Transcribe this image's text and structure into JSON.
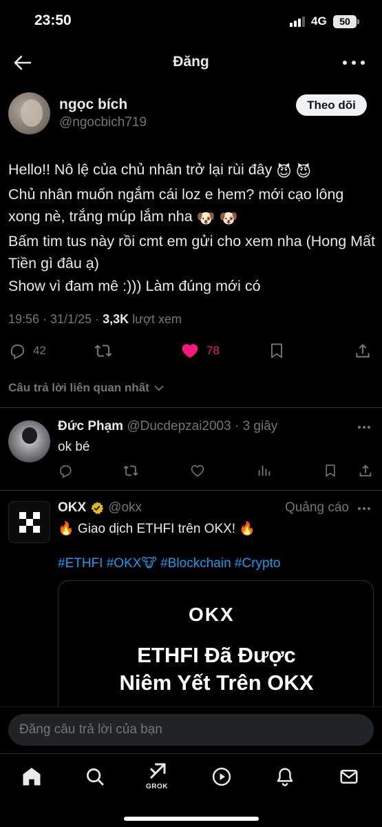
{
  "status_bar": {
    "time": "23:50",
    "network": "4G",
    "battery": "50"
  },
  "header": {
    "title": "Đăng"
  },
  "tweet": {
    "author_name": "ngọc bích",
    "author_handle": "@ngocbich719",
    "follow_label": "Theo dõi",
    "lines": [
      "Hello!! Nô lệ của chủ nhân trở lại rùi đây",
      "Chủ nhân muốn ngắm cái loz e hem? mới cạo lông xong nè, trắng múp lắm nha",
      "Bấm tim tus này rồi cmt em gửi cho xem nha (Hong Mất Tiền gì đâu ạ)",
      "Show vì đam mê :))) Làm đúng mới có"
    ],
    "emoji_line1": "😈 😈",
    "emoji_line2": "🐶 🐶",
    "time": "19:56 · 31/1/25 · ",
    "views": "3,3K",
    "views_label": " lượt xem",
    "reply_count": "42",
    "like_count": "78"
  },
  "replies_filter": {
    "label": "Câu trả lời liên quan nhất"
  },
  "reply": {
    "author_name": "Đức Phạm",
    "author_handle": " @Ducdepzai2003 · 3 giây",
    "text": "ok bé"
  },
  "ad": {
    "author_name": "OKX",
    "author_handle": "@okx",
    "label": "Quảng cáo",
    "text": "🔥 Giao dịch ETHFI trên OKX! 🔥",
    "tags": "#ETHFI #OKX🐮 #Blockchain #Crypto",
    "card_logo": "OKX",
    "card_headline_1": "ETHFI Đã Được",
    "card_headline_2": "Niêm Yết Trên OKX"
  },
  "composer": {
    "placeholder": "Đăng câu trả lời của bạn"
  },
  "bottom_nav": {
    "grok_label": "GROK"
  },
  "icons": [
    "back-arrow-icon",
    "more-icon",
    "reply-icon",
    "retweet-icon",
    "heart-icon",
    "bookmark-icon",
    "share-icon",
    "chevron-down-icon",
    "views-icon",
    "verified-badge-icon",
    "home-icon",
    "search-icon",
    "grok-icon",
    "play-icon",
    "bell-icon",
    "mail-icon"
  ],
  "colors": {
    "like": "#f91880",
    "link": "#1d9bf0",
    "muted": "#71767b",
    "text": "#e7e9ea",
    "verified": "#e2b719"
  }
}
